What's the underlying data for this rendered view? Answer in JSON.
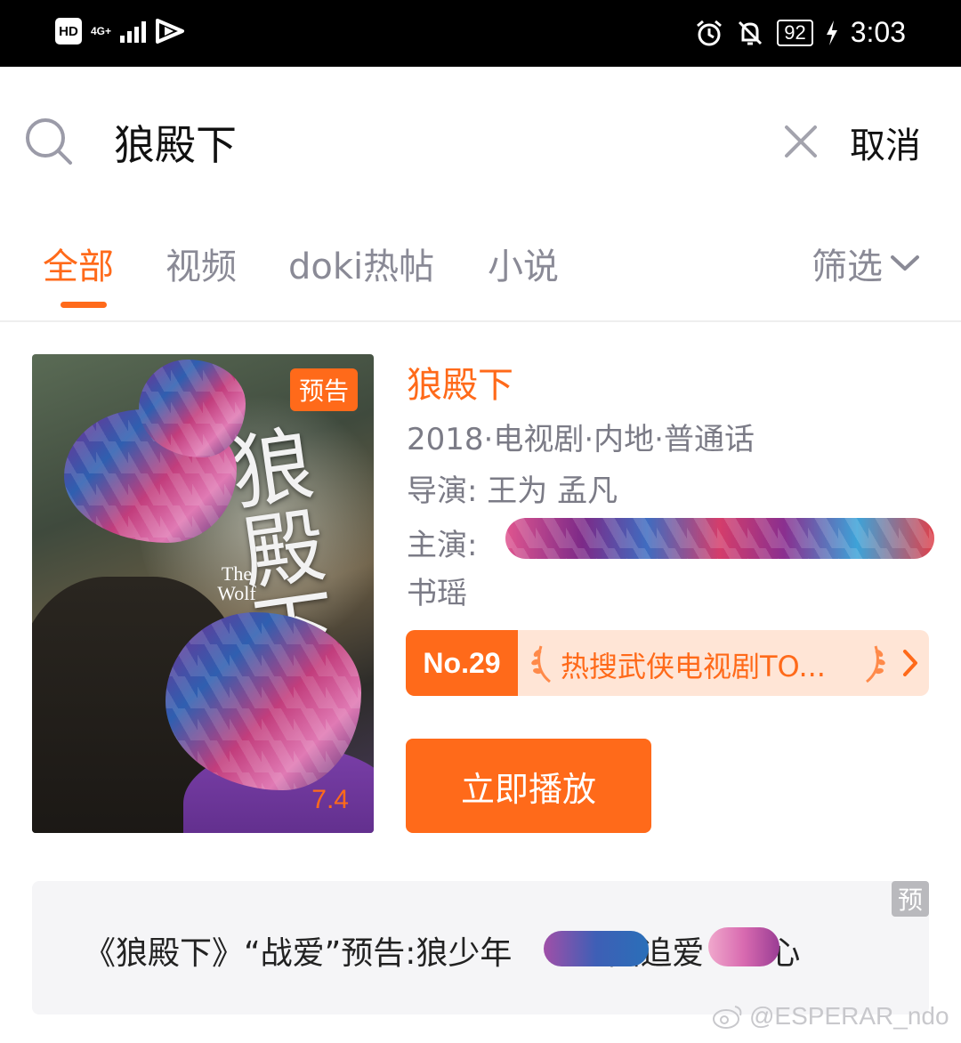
{
  "status_bar": {
    "hd": "HD",
    "network": "4G+",
    "battery": "92",
    "time": "3:03"
  },
  "search": {
    "query": "狼殿下",
    "cancel_label": "取消"
  },
  "tabs": [
    {
      "label": "全部",
      "active": true
    },
    {
      "label": "视频",
      "active": false
    },
    {
      "label": "doki热帖",
      "active": false
    },
    {
      "label": "小说",
      "active": false
    }
  ],
  "filter_label": "筛选",
  "result": {
    "title": "狼殿下",
    "meta": "2018·电视剧·内地·普通话",
    "director_label": "导演:",
    "directors": "王为 孟凡",
    "actors_label": "主演:",
    "actors_tail": "书瑶",
    "poster": {
      "badge": "预告",
      "art_title": "狼殿下",
      "art_subtitle": "The Wolf",
      "score": "7.4"
    },
    "rank": {
      "number": "No.29",
      "text": "热搜武侠电视剧TO..."
    },
    "play_label": "立即播放"
  },
  "trailer": {
    "tag": "预",
    "text": "《狼殿下》“战爱”预告:狼少年　　　陆追爱　　心"
  },
  "watermark": "@ESPERAR_ndo",
  "colors": {
    "accent": "#ff6a1a",
    "muted_text": "#8a8a96"
  }
}
